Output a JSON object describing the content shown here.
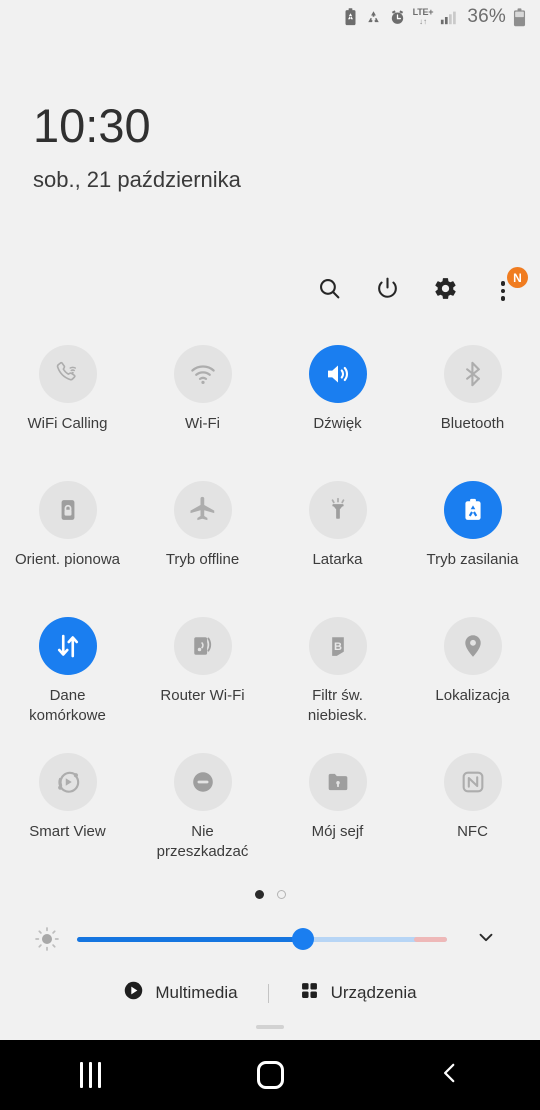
{
  "statusbar": {
    "icons": [
      "power-saving-battery-icon",
      "recycle-icon",
      "alarm-icon",
      "lte-plus-icon",
      "signal-bars-icon"
    ],
    "network_label": "LTE+",
    "network_sub": "↓↑",
    "battery_percent": "36%"
  },
  "clock": {
    "time": "10:30",
    "date": "sob., 21 października"
  },
  "actions": [
    {
      "name": "search-button",
      "icon": "search-icon",
      "badge": ""
    },
    {
      "name": "power-button",
      "icon": "power-icon",
      "badge": ""
    },
    {
      "name": "settings-button",
      "icon": "gear-icon",
      "badge": ""
    },
    {
      "name": "more-options-button",
      "icon": "three-dots-icon",
      "badge": "N"
    }
  ],
  "tiles": [
    {
      "label": "WiFi Calling",
      "icon": "wifi-calling-icon",
      "active": false
    },
    {
      "label": "Wi-Fi",
      "icon": "wifi-icon",
      "active": false
    },
    {
      "label": "Dźwięk",
      "icon": "sound-icon",
      "active": true
    },
    {
      "label": "Bluetooth",
      "icon": "bluetooth-icon",
      "active": false
    },
    {
      "label": "Orient. pionowa",
      "icon": "rotation-lock-icon",
      "active": false
    },
    {
      "label": "Tryb offline",
      "icon": "airplane-icon",
      "active": false
    },
    {
      "label": "Latarka",
      "icon": "flashlight-icon",
      "active": false
    },
    {
      "label": "Tryb zasilania",
      "icon": "power-mode-icon",
      "active": true
    },
    {
      "label": "Dane komórkowe",
      "icon": "mobile-data-icon",
      "active": true
    },
    {
      "label": "Router Wi-Fi",
      "icon": "hotspot-icon",
      "active": false
    },
    {
      "label": "Filtr św. niebiesk.",
      "icon": "blue-light-icon",
      "active": false
    },
    {
      "label": "Lokalizacja",
      "icon": "location-pin-icon",
      "active": false
    },
    {
      "label": "Smart View",
      "icon": "smart-view-icon",
      "active": false
    },
    {
      "label": "Nie przeszkadzać",
      "icon": "do-not-disturb-icon",
      "active": false
    },
    {
      "label": "Mój sejf",
      "icon": "secure-folder-icon",
      "active": false
    },
    {
      "label": "NFC",
      "icon": "nfc-icon",
      "active": false
    }
  ],
  "pages": {
    "count": 2,
    "current": 1
  },
  "brightness": {
    "icon": "brightness-sun-icon",
    "value_percent": 61,
    "warn_zone_percent": 91,
    "expand_icon": "chevron-down-icon"
  },
  "footer": {
    "media_label": "Multimedia",
    "media_icon": "play-circle-icon",
    "devices_label": "Urządzenia",
    "devices_icon": "grid-dots-icon"
  },
  "navbar": {
    "recents_label": "recents-icon",
    "home_label": "home-icon",
    "back_label": "back-icon"
  },
  "colors": {
    "accent": "#1a7ef0",
    "panel_bg": "#f1f1f1",
    "tile_off_bg": "#e3e3e3",
    "badge": "#f07c20"
  }
}
